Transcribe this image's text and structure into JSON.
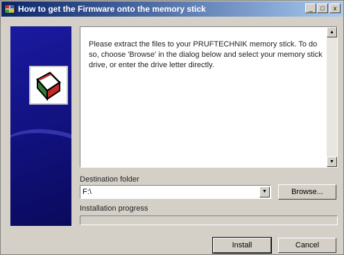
{
  "window": {
    "title": "How to get the Firmware onto the memory stick",
    "minimize_glyph": "_",
    "maximize_glyph": "□",
    "close_glyph": "x"
  },
  "instructions": "Please extract the files to your PRUFTECHNIK memory stick. To do so, choose 'Browse' in the dialog below and select your memory stick drive, or enter the drive letter directly.",
  "destination": {
    "label": "Destination folder",
    "value": "F:\\",
    "browse_label": "Browse..."
  },
  "progress": {
    "label": "Installation progress",
    "value": 0
  },
  "buttons": {
    "install": "Install",
    "cancel": "Cancel"
  },
  "colors": {
    "title_start": "#0a246a",
    "title_end": "#a6caf0",
    "sidebar": "#10107a",
    "face": "#d4d0c8"
  }
}
